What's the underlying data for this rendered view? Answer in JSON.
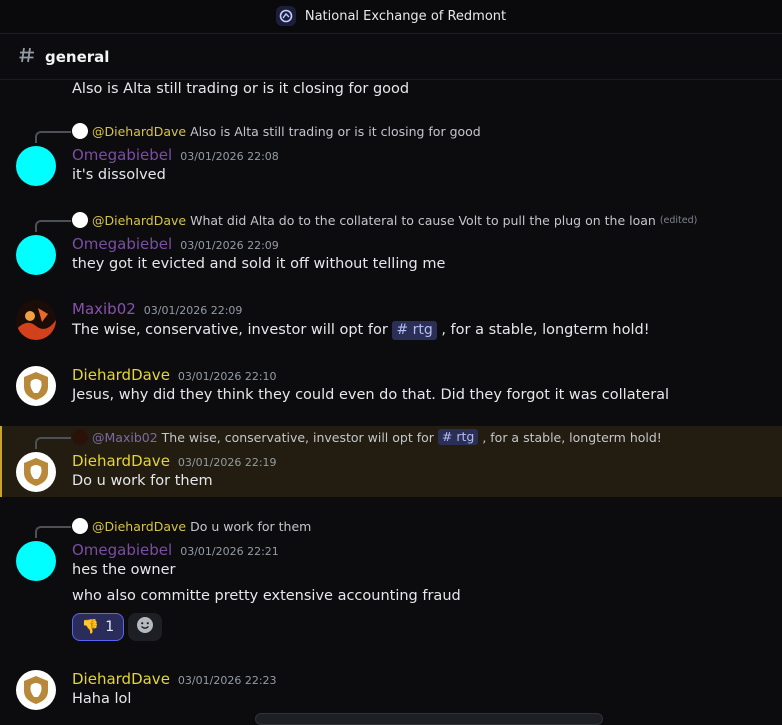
{
  "titlebar": {
    "server_name": "National Exchange of Redmont"
  },
  "channel": {
    "name": "general"
  },
  "colors": {
    "accent_mention": "#d7c443",
    "highlight": "#c8a42b",
    "reaction_border": "#5865f2"
  },
  "messages": [
    {
      "content": "Also is Alta still trading or is it closing for good"
    },
    {
      "reply": {
        "mention": "@DiehardDave",
        "text": "Also is Alta still trading or is it closing for good"
      },
      "author": "Omegabiebel",
      "timestamp": "03/01/2026 22:08",
      "content": "it's dissolved"
    },
    {
      "reply": {
        "mention": "@DiehardDave",
        "text": "What did Alta do to the collateral to cause Volt to pull the plug on the loan",
        "edited": "(edited)"
      },
      "author": "Omegabiebel",
      "timestamp": "03/01/2026 22:09",
      "content": "they got it evicted and sold it off without telling me"
    },
    {
      "author": "Maxib02",
      "timestamp": "03/01/2026 22:09",
      "content_pre": "The wise, conservative, investor will opt for",
      "channel_tag": "# rtg",
      "content_post": ", for a stable, longterm hold!"
    },
    {
      "author": "DiehardDave",
      "timestamp": "03/01/2026 22:10",
      "content": "Jesus, why did they think they could even do that. Did they forgot it was collateral"
    },
    {
      "reply": {
        "mention": "@Maxib02",
        "text_pre": "The wise, conservative, investor will opt for",
        "channel_tag": "# rtg",
        "text_post": ", for a stable, longterm hold!"
      },
      "author": "DiehardDave",
      "timestamp": "03/01/2026 22:19",
      "content": "Do u work for them"
    },
    {
      "reply": {
        "mention": "@DiehardDave",
        "text": "Do u work for them"
      },
      "author": "Omegabiebel",
      "timestamp": "03/01/2026 22:21",
      "content": "hes the owner",
      "content2": "who also committe pretty extensive accounting fraud",
      "reaction": {
        "emoji": "👎",
        "count": "1"
      },
      "add_reaction_icon": "smiley-icon"
    },
    {
      "author": "DiehardDave",
      "timestamp": "03/01/2026 22:23",
      "content": "Haha lol"
    }
  ]
}
